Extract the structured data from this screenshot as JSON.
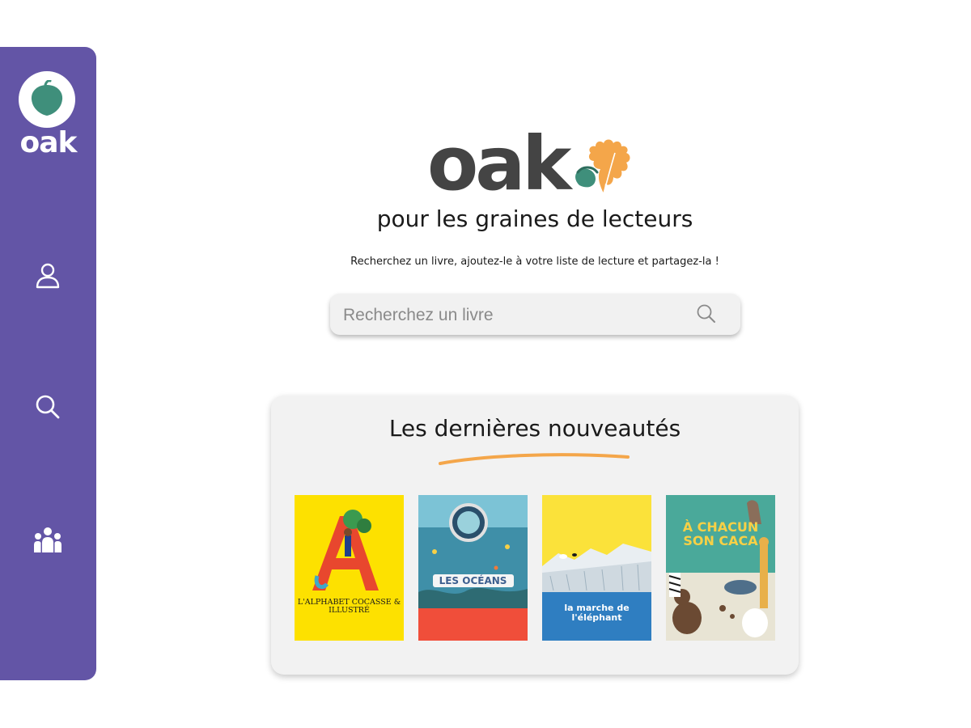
{
  "sidebar": {
    "logo_text": "oak",
    "items": [
      {
        "name": "profile",
        "icon": "user-icon"
      },
      {
        "name": "search",
        "icon": "search-icon"
      },
      {
        "name": "community",
        "icon": "group-icon"
      }
    ]
  },
  "hero": {
    "logo_text": "oak",
    "tagline": "pour les graines de lecteurs",
    "subtext": "Recherchez un livre, ajoutez-le à votre liste de lecture et partagez-la !"
  },
  "search": {
    "placeholder": "Recherchez un livre",
    "value": "",
    "icon": "search-icon"
  },
  "new_releases": {
    "title": "Les dernières nouveautés",
    "books": [
      {
        "cover_text": "L'ALPHABET COCASSE & ILLUSTRÉ"
      },
      {
        "cover_text": "LES OCÉANS"
      },
      {
        "cover_text": "la marche de l'éléphant"
      },
      {
        "cover_text": "À CHACUN SON CACA"
      }
    ]
  },
  "colors": {
    "sidebar": "#6355a6",
    "acorn_green": "#3f8f7b",
    "leaf_orange": "#f4a64a",
    "logo_gray": "#444444",
    "card_bg": "#f2f2f2"
  }
}
